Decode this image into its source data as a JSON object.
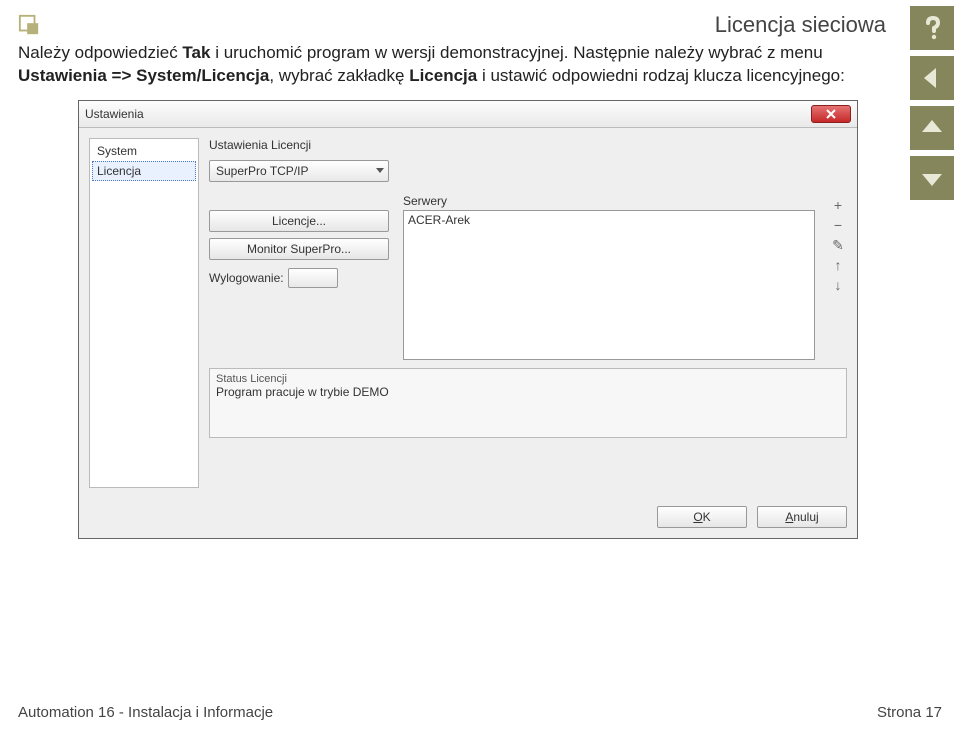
{
  "header": {
    "title": "Licencja sieciowa"
  },
  "paragraph": {
    "p1a": "Należy odpowiedzieć ",
    "p1b": "Tak",
    "p1c": " i uruchomić program w wersji demonstracyjnej. Następnie należy wybrać z menu ",
    "p1d": "Ustawienia => System/Licencja",
    "p1e": ", wybrać zakładkę ",
    "p1f": "Licencja",
    "p1g": " i ustawić odpowiedni rodzaj klucza licencyjnego:"
  },
  "dialog": {
    "title": "Ustawienia",
    "left": {
      "items": [
        "System",
        "Licencja"
      ],
      "selected_index": 1
    },
    "group_label": "Ustawienia Licencji",
    "type_combo": "SuperPro TCP/IP",
    "btn_licencje": "Licencje...",
    "btn_monitor": "Monitor SuperPro...",
    "wylogowanie_label": "Wylogowanie:",
    "serwery_label": "Serwery",
    "servers": [
      "ACER-Arek"
    ],
    "status_label": "Status Licencji",
    "status_text": "Program pracuje w trybie DEMO",
    "ok_label": "OK",
    "ok_u": "O",
    "ok_rest": "K",
    "anuluj_label": "Anuluj",
    "anuluj_u": "A",
    "anuluj_rest": "nuluj"
  },
  "footer": {
    "left": "Automation 16 - Instalacja i Informacje",
    "right": "Strona 17"
  },
  "icons": {
    "plus": "+",
    "minus": "−",
    "pencil": "✎",
    "up": "↑",
    "down": "↓"
  }
}
